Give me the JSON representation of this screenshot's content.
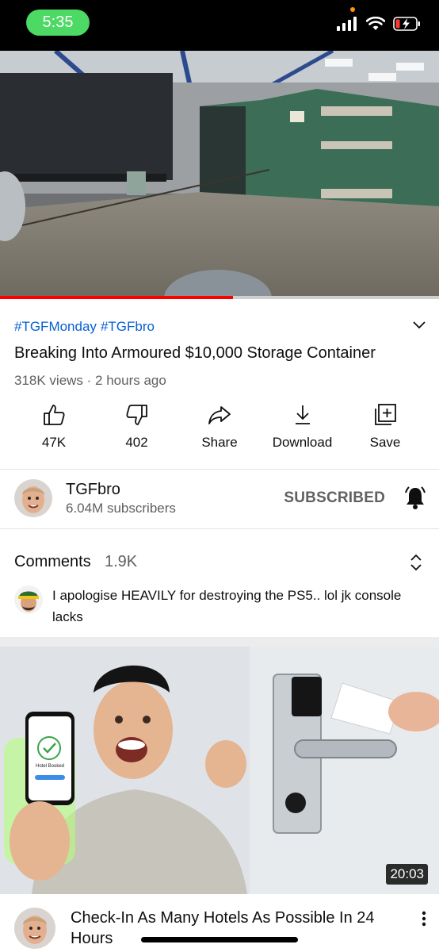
{
  "status_bar": {
    "time": "5:35"
  },
  "player": {
    "progress_fraction": 0.53
  },
  "video": {
    "hashtags": [
      "#TGFMonday",
      "#TGFbro"
    ],
    "title": "Breaking Into Armoured $10,000 Storage Container",
    "stats": "318K views · 2 hours ago"
  },
  "actions": {
    "like": "47K",
    "dislike": "402",
    "share": "Share",
    "download": "Download",
    "save": "Save"
  },
  "channel": {
    "name": "TGFbro",
    "subscribers": "6.04M subscribers",
    "subscribe_state": "SUBSCRIBED"
  },
  "comments": {
    "label": "Comments",
    "count": "1.9K",
    "top_comment": "I apologise HEAVILY for destroying the PS5.. lol jk console lacks"
  },
  "next_video": {
    "duration": "20:03",
    "title": "Check-In As Many Hotels As Possible In 24 Hours",
    "phone_text": "Hotel Booked"
  },
  "colors": {
    "accent_red": "#ff0000",
    "link_blue": "#065fd4",
    "time_pill_green": "#4cd964"
  }
}
